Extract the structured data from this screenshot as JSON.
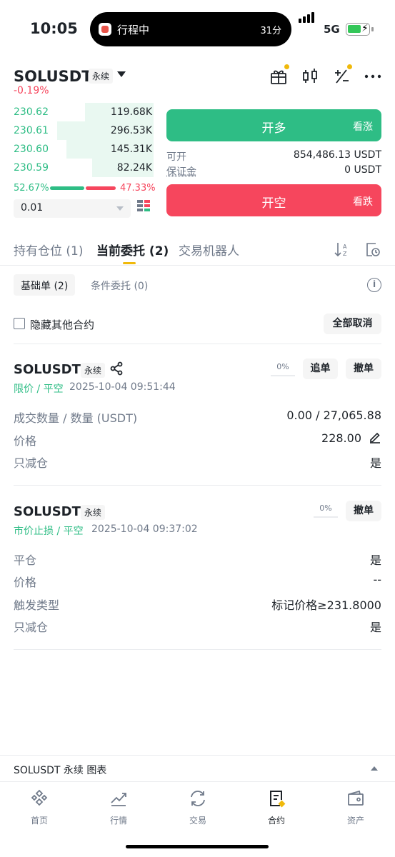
{
  "status_bar": {
    "time": "10:05",
    "activity_label": "行程中",
    "activity_right": "31分",
    "network": "5G"
  },
  "header": {
    "symbol": "SOLUSDT",
    "contract_type": "永续",
    "change": "-0.19%"
  },
  "order_book": {
    "rows": [
      {
        "price": "230.62",
        "qty": "119.68K",
        "depth": 0.49
      },
      {
        "price": "230.61",
        "qty": "296.53K",
        "depth": 0.69
      },
      {
        "price": "230.60",
        "qty": "145.31K",
        "depth": 0.62
      },
      {
        "price": "230.59",
        "qty": "82.24K",
        "depth": 0.44
      }
    ],
    "buy_ratio": "52.67%",
    "sell_ratio": "47.33%",
    "precision": "0.01"
  },
  "trade": {
    "long_label": "开多",
    "long_sub": "看涨",
    "short_label": "开空",
    "short_sub": "看跌",
    "available_label": "可开",
    "available_value": "854,486.13 USDT",
    "margin_label": "保证金",
    "margin_value": "0 USDT"
  },
  "tabs": {
    "positions": "持有仓位 (1)",
    "open_orders": "当前委托 (2)",
    "bots": "交易机器人"
  },
  "subtabs": {
    "basic": "基础单 (2)",
    "conditional": "条件委托 (0)"
  },
  "filter": {
    "hide_others": "隐藏其他合约",
    "cancel_all": "全部取消"
  },
  "orders": [
    {
      "symbol": "SOLUSDT",
      "contract_type": "永续",
      "type": "限价 / 平空",
      "time": "2025-10-04 09:51:44",
      "progress": "0%",
      "chase_label": "追单",
      "cancel_label": "撤单",
      "rows": [
        {
          "label": "成交数量 / 数量 (USDT)",
          "value": "0.00 / 27,065.88"
        },
        {
          "label": "价格",
          "value": "228.00"
        },
        {
          "label": "只减仓",
          "value": "是"
        }
      ]
    },
    {
      "symbol": "SOLUSDT",
      "contract_type": "永续",
      "type": "市价止损 / 平空",
      "time": "2025-10-04 09:37:02",
      "progress": "0%",
      "cancel_label": "撤单",
      "rows": [
        {
          "label": "平仓",
          "value": "是"
        },
        {
          "label": "价格",
          "value": "--"
        },
        {
          "label": "触发类型",
          "value": "标记价格≥231.8000"
        },
        {
          "label": "只减仓",
          "value": "是"
        }
      ]
    }
  ],
  "chart_bar": {
    "label": "SOLUSDT 永续  图表"
  },
  "nav": [
    {
      "label": "首页",
      "icon": "home-icon"
    },
    {
      "label": "行情",
      "icon": "markets-icon"
    },
    {
      "label": "交易",
      "icon": "trade-icon"
    },
    {
      "label": "合约",
      "icon": "futures-icon"
    },
    {
      "label": "资产",
      "icon": "wallet-icon"
    }
  ],
  "colors": {
    "green": "#2ebd85",
    "red": "#f6465d",
    "accent": "#f0b90b"
  }
}
